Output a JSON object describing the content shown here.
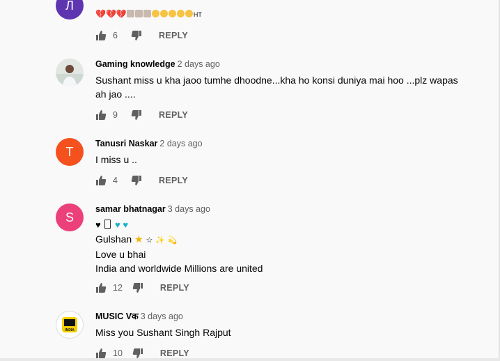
{
  "comments": [
    {
      "avatar_letter": "Л",
      "avatar_color": "#5e35b1",
      "author": "",
      "time": "",
      "emoji_suffix": "HT",
      "likes": "6",
      "reply": "REPLY"
    },
    {
      "author": "Gaming knowledge",
      "time": "2 days ago",
      "text_line1": "Sushant miss u kha jaoo tumhe dhoodne...kha ho konsi duniya mai hoo ...plz wapas",
      "text_line2": "ah jao ....",
      "likes": "9",
      "reply": "REPLY"
    },
    {
      "avatar_letter": "T",
      "avatar_color": "#f4511e",
      "author": "Tanusri Naskar",
      "time": "2 days ago",
      "text": "I miss u ..",
      "likes": "4",
      "reply": "REPLY"
    },
    {
      "avatar_letter": "S",
      "avatar_color": "#ec407a",
      "author": "samar bhatnagar",
      "time": "3 days ago",
      "line_gulshan": "Gulshan",
      "line_love": "Love u bhai",
      "line_india": "India and worldwide Millions are united",
      "likes": "12",
      "reply": "REPLY"
    },
    {
      "avatar_text": "INDIA",
      "author": "MUSIC Vक",
      "time": "3 days ago",
      "text": "Miss you Sushant Singh Rajput",
      "likes": "10",
      "reply": "REPLY"
    }
  ]
}
